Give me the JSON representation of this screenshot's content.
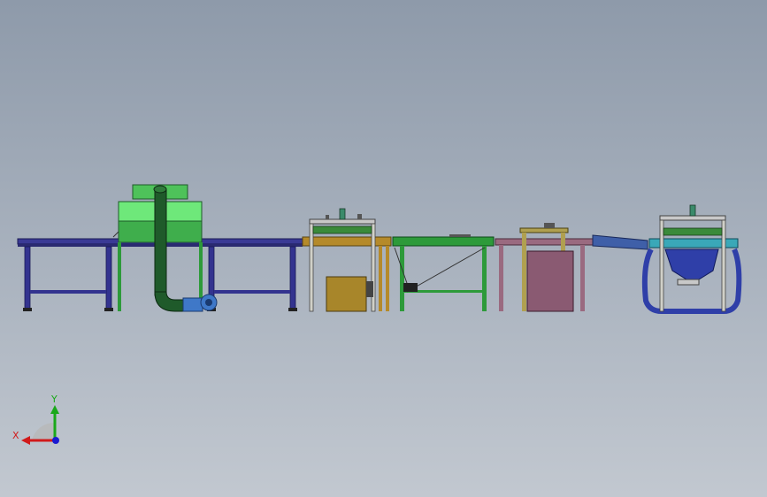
{
  "viewport": {
    "background_top": "#8e9aaa",
    "background_bottom": "#c2c8d0"
  },
  "triad": {
    "x_label": "X",
    "y_label": "Y",
    "x_color": "#d11a1a",
    "y_color": "#1aa81a",
    "z_color": "#1a1ad1"
  },
  "colors": {
    "conveyor_blue": "#33338f",
    "frame_green": "#2d9a3a",
    "hood_green": "#5ddc6a",
    "duct_green": "#1f5a2a",
    "fan_blue": "#3f78c8",
    "frame_olive": "#9a8e3a",
    "box_gold": "#a8862a",
    "frame_mauve": "#9a6a80",
    "box_mauve": "#8a5a72",
    "teal": "#3aa8b8",
    "hopper_blue": "#2f3fa8"
  },
  "scene_items": [
    "input-conveyor",
    "dust-hood",
    "exhaust-duct",
    "exhaust-fan",
    "station-2-frame",
    "station-2-motor-box",
    "transfer-conveyor",
    "station-4-frame",
    "station-4-cabinet",
    "chute",
    "hopper-station"
  ]
}
